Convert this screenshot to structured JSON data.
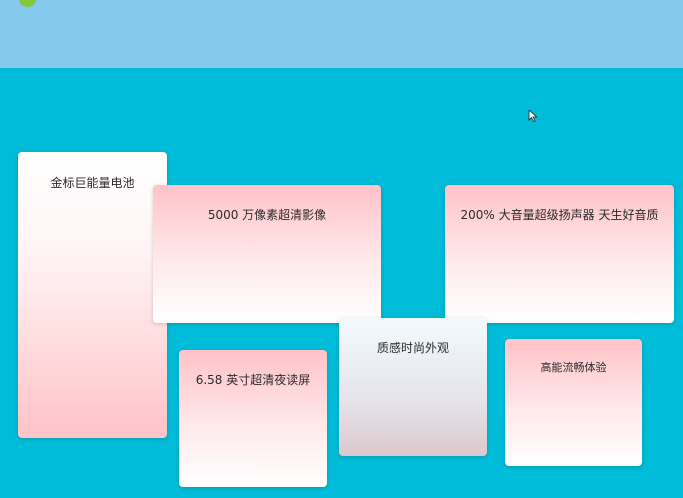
{
  "colors": {
    "background": "#00bcd8",
    "top_band": "#85c9ee",
    "card_pink": "#ffc2c7",
    "card_white": "#ffffff",
    "top_icon": "#82c83a"
  },
  "icons": {
    "top_icon": "app-icon",
    "cursor": "cursor-arrow-icon"
  },
  "cards": [
    {
      "label": "金标巨能量电池"
    },
    {
      "label": "5000 万像素超清影像"
    },
    {
      "label": "200% 大音量超级扬声器 天生好音质"
    },
    {
      "label": "质感时尚外观"
    },
    {
      "label": "6.58 英寸超清夜读屏"
    },
    {
      "label": "高能流畅体验"
    }
  ]
}
